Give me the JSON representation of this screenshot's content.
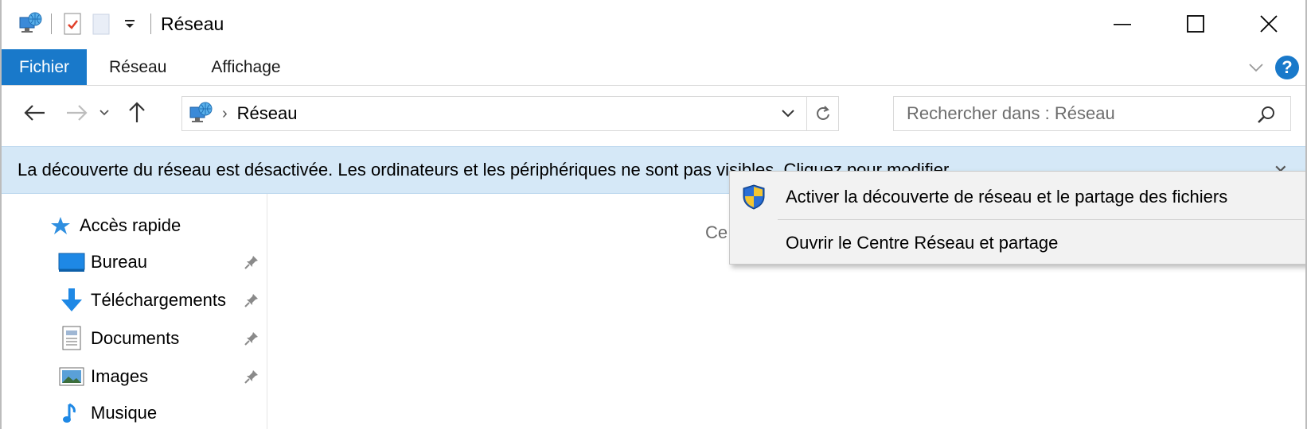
{
  "titlebar": {
    "title": "Réseau",
    "quick_access_icons": [
      "network-icon",
      "properties-icon",
      "new-folder-icon",
      "customize-dropdown-icon"
    ],
    "window_buttons": [
      "minimize-icon",
      "maximize-icon",
      "close-icon"
    ]
  },
  "ribbon": {
    "tabs": [
      {
        "label": "Fichier",
        "active": true
      },
      {
        "label": "Réseau",
        "active": false
      },
      {
        "label": "Affichage",
        "active": false
      }
    ],
    "accent_color": "#1979ca"
  },
  "address": {
    "crumb": "Réseau",
    "separator": "›"
  },
  "search": {
    "placeholder": "Rechercher dans : Réseau"
  },
  "infobar": {
    "message": "La découverte du réseau est désactivée. Les ordinateurs et les périphériques ne sont pas visibles. Cliquez pour modifier...",
    "background": "#d5e8f7"
  },
  "navpane": {
    "quick_access": "Accès rapide",
    "items": [
      {
        "label": "Bureau",
        "icon": "desktop-icon",
        "pinned": true
      },
      {
        "label": "Téléchargements",
        "icon": "download-icon",
        "pinned": true
      },
      {
        "label": "Documents",
        "icon": "documents-icon",
        "pinned": true
      },
      {
        "label": "Images",
        "icon": "images-icon",
        "pinned": true
      },
      {
        "label": "Musique",
        "icon": "music-icon",
        "pinned": false
      }
    ]
  },
  "content": {
    "peek_text": "Ce"
  },
  "context_menu": {
    "items": [
      {
        "label": "Activer la découverte de réseau et le partage des fichiers",
        "icon": "uac-shield-icon"
      },
      {
        "label": "Ouvrir le Centre Réseau et partage",
        "icon": ""
      }
    ]
  }
}
